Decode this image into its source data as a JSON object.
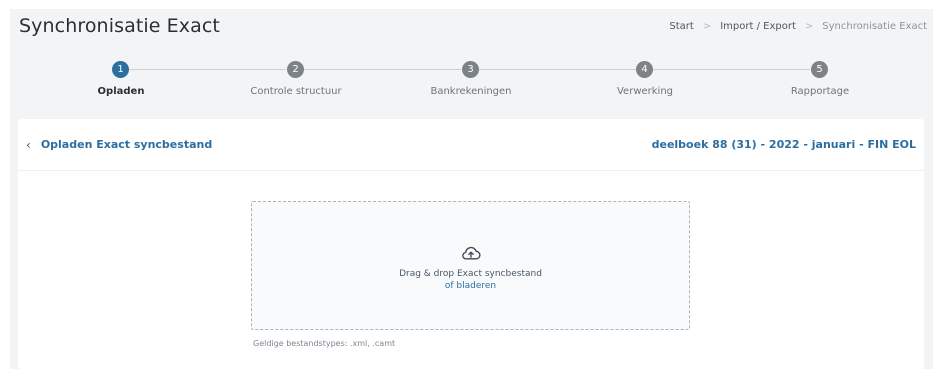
{
  "header": {
    "title": "Synchronisatie Exact",
    "breadcrumb": [
      "Start",
      "Import / Export",
      "Synchronisatie Exact"
    ],
    "breadcrumb_separator": ">"
  },
  "stepper": {
    "active_index": 0,
    "steps": [
      {
        "number": "1",
        "label": "Opladen"
      },
      {
        "number": "2",
        "label": "Controle structuur"
      },
      {
        "number": "3",
        "label": "Bankrekeningen"
      },
      {
        "number": "4",
        "label": "Verwerking"
      },
      {
        "number": "5",
        "label": "Rapportage"
      }
    ]
  },
  "card": {
    "back_icon": "chevron-left-icon",
    "title": "Opladen Exact syncbestand",
    "context": "deelboek 88 (31) - 2022 - januari - FIN EOL"
  },
  "dropzone": {
    "icon": "cloud-upload-icon",
    "text": "Drag & drop Exact syncbestand",
    "browse_link": "of bladeren",
    "filetypes_hint": "Geldige bestandstypes: .xml, .camt"
  },
  "colors": {
    "accent": "#2c6ea0",
    "inactive_step": "#7d8287",
    "background": "#f3f4f6"
  }
}
